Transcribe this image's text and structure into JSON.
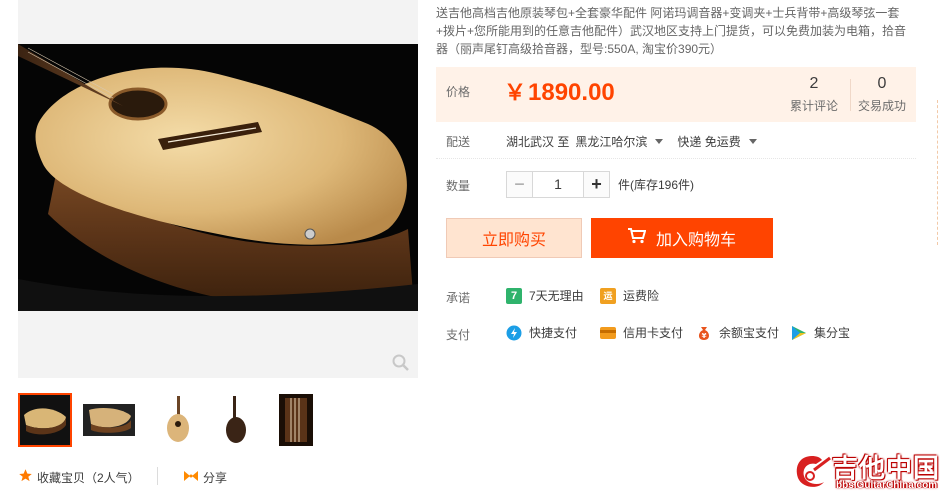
{
  "product": {
    "title": "送吉他高档吉他原装琴包+全套豪华配件 阿诺玛调音器+变调夹+士兵背带+高级琴弦一套+拨片+您所能用到的任意吉他配件）武汉地区支持上门提货，可以免费加装为电箱，拾音器（丽声尾钉高级拾音器，型号:550A, 淘宝价390元）"
  },
  "price": {
    "label": "价格",
    "currency": "￥",
    "value": "1890.00",
    "reviews_count": "2",
    "reviews_label": "累计评论",
    "deals_count": "0",
    "deals_label": "交易成功"
  },
  "shipping": {
    "label": "配送",
    "from_text": "湖北武汉 至",
    "to_text": "黑龙江哈尔滨",
    "method": "快递 免运费"
  },
  "quantity": {
    "label": "数量",
    "minus": "−",
    "value": "1",
    "plus": "+",
    "stock_text": "件(库存196件)"
  },
  "actions": {
    "buy_now": "立即购买",
    "add_to_cart": "加入购物车"
  },
  "promise": {
    "label": "承诺",
    "items": [
      {
        "icon": "7-day-return-icon",
        "glyph": "7",
        "text": "7天无理由",
        "color": "#2fb36c"
      },
      {
        "icon": "shipping-insurance-icon",
        "glyph": "运",
        "text": "运费险",
        "color": "#f0a020"
      }
    ]
  },
  "payment": {
    "label": "支付",
    "items": [
      {
        "icon": "quick-pay-icon",
        "text": "快捷支付"
      },
      {
        "icon": "credit-card-icon",
        "text": "信用卡支付"
      },
      {
        "icon": "yuebao-icon",
        "text": "余额宝支付"
      },
      {
        "icon": "jifenbao-icon",
        "text": "集分宝"
      }
    ]
  },
  "gallery": {
    "thumbs": [
      "thumb-1",
      "thumb-2",
      "thumb-3",
      "thumb-4",
      "thumb-5"
    ],
    "favorite_text": "收藏宝贝（2人气）",
    "share_text": "分享"
  },
  "watermark": {
    "text": "吉他中国",
    "url": "bbs.GuitarChina.com"
  },
  "colors": {
    "accent": "#ff4400",
    "price_bg": "#fff2e8"
  }
}
